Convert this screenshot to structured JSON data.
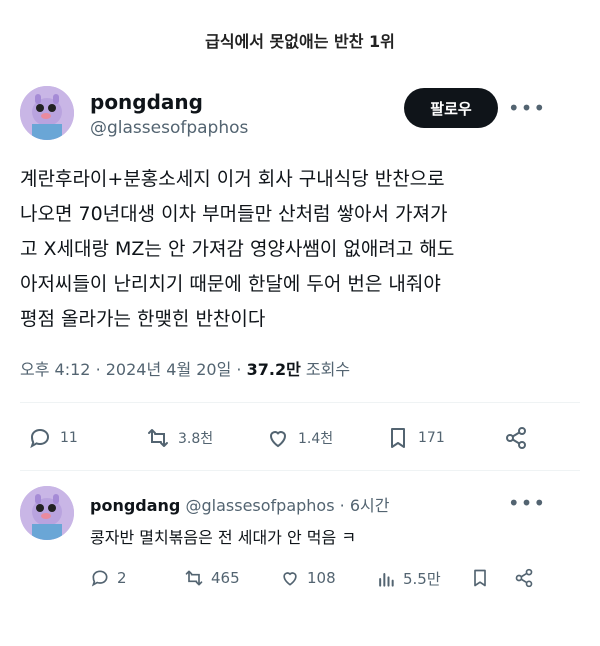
{
  "page_title": "급식에서 못없애는 반찬 1위",
  "main_tweet": {
    "author": {
      "name": "pongdang",
      "handle": "@glassesofpaphos"
    },
    "follow_label": "팔로우",
    "text": "계란후라이+분홍소세지 이거 회사 구내식당 반찬으로\n나오면 70년대생 이차 부머들만 산처럼 쌓아서 가져가\n고 X세대랑 MZ는 안 가져감 영양사쌤이 없애려고 해도\n아저씨들이 난리치기 때문에 한달에 두어 번은 내줘야\n평점 올라가는 한맺힌 반찬이다",
    "time": "오후 4:12",
    "date": "2024년 4월 20일",
    "views_count": "37.2만",
    "views_label": "조회수",
    "actions": {
      "replies": "11",
      "retweets": "3.8천",
      "likes": "1.4천",
      "bookmarks": "171"
    }
  },
  "reply_tweet": {
    "author": {
      "name": "pongdang",
      "handle": "@glassesofpaphos"
    },
    "time_ago": "6시간",
    "text": "콩자반 멸치볶음은 전 세대가 안 먹음 ㅋ",
    "actions": {
      "replies": "2",
      "retweets": "465",
      "likes": "108",
      "views": "5.5만"
    }
  },
  "colors": {
    "text": "#0f1419",
    "secondary": "#536471",
    "follow_bg": "#0f1419",
    "avatar_bg": "#c9b6e6"
  },
  "icons": [
    "more-icon",
    "reply-icon",
    "retweet-icon",
    "like-icon",
    "bookmark-icon",
    "share-icon",
    "views-icon"
  ]
}
